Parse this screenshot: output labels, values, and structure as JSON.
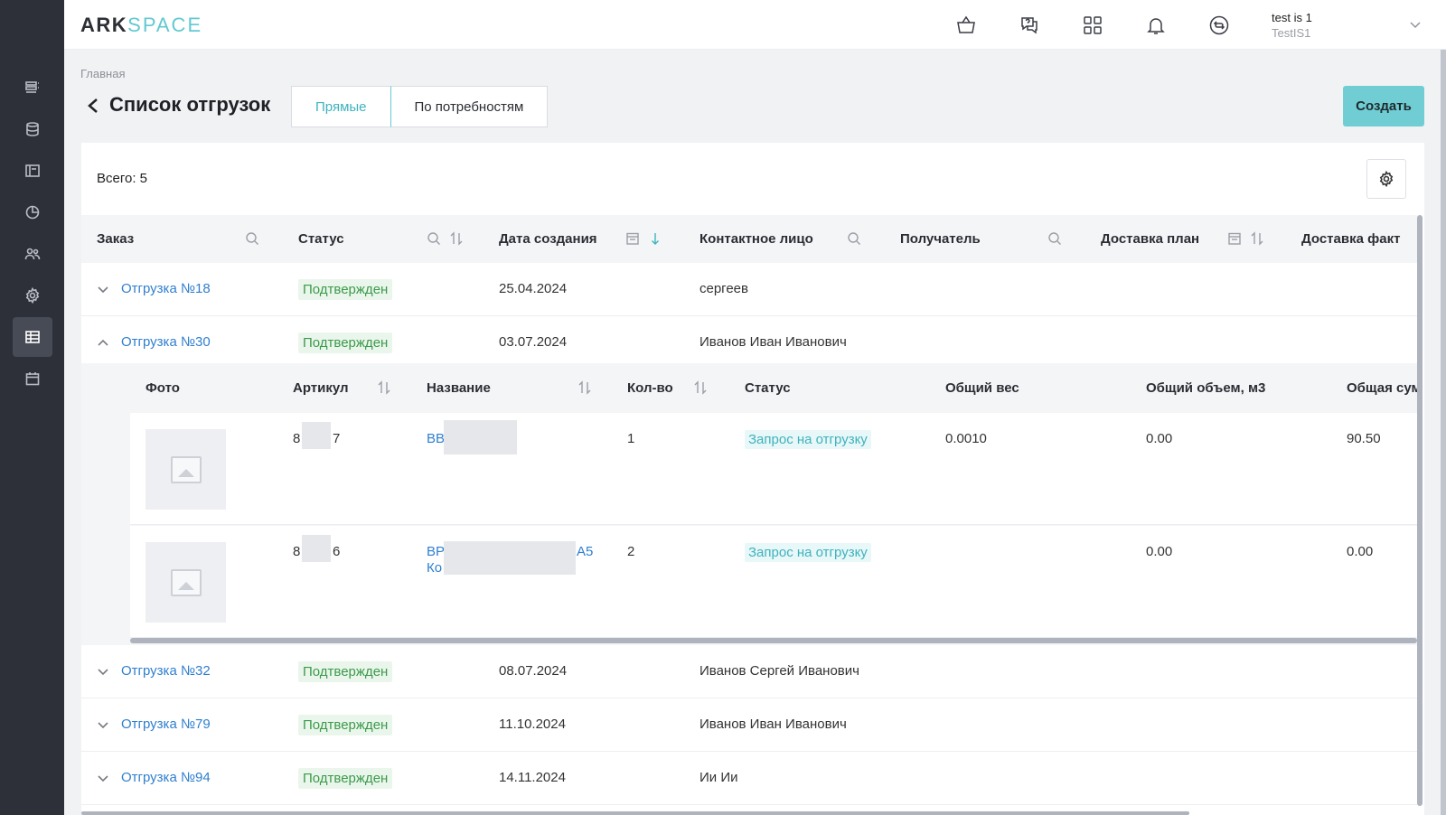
{
  "app": {
    "logo_a": "ARK",
    "logo_b": "SPACE"
  },
  "sidebar": {
    "items": [
      {
        "icon": "list-icon"
      },
      {
        "icon": "database-icon"
      },
      {
        "icon": "layout-icon"
      },
      {
        "icon": "pie-chart-icon"
      },
      {
        "icon": "users-icon"
      },
      {
        "icon": "gear-icon"
      },
      {
        "icon": "shipment-table-icon",
        "active": true
      },
      {
        "icon": "calendar-icon"
      }
    ]
  },
  "header": {
    "user_name": "test is 1",
    "user_org": "TestIS1",
    "icons": [
      "basket-icon",
      "chat-help-icon",
      "apps-grid-icon",
      "bell-icon",
      "sync-icon"
    ]
  },
  "page": {
    "breadcrumb": "Главная",
    "title": "Список отгрузок",
    "tabs": [
      {
        "label": "Прямые",
        "active": true
      },
      {
        "label": "По потребностям",
        "active": false
      }
    ],
    "create_label": "Создать"
  },
  "table": {
    "total": "Всего: 5",
    "columns": [
      "Заказ",
      "Статус",
      "Дата создания",
      "Контактное лицо",
      "Получатель",
      "Доставка план",
      "Доставка факт"
    ],
    "rows": [
      {
        "order": "Отгрузка №18",
        "status": "Подтвержден",
        "date": "25.04.2024",
        "contact": "сергеев"
      },
      {
        "order": "Отгрузка №30",
        "status": "Подтвержден",
        "date": "03.07.2024",
        "contact": "Иванов Иван Иванович"
      },
      {
        "order": "Отгрузка №32",
        "status": "Подтвержден",
        "date": "08.07.2024",
        "contact": "Иванов Сергей Иванович"
      },
      {
        "order": "Отгрузка №79",
        "status": "Подтвержден",
        "date": "11.10.2024",
        "contact": "Иванов Иван Иванович"
      },
      {
        "order": "Отгрузка №94",
        "status": "Подтвержден",
        "date": "14.11.2024",
        "contact": "Ии Ии"
      }
    ]
  },
  "nested": {
    "columns": [
      "Фото",
      "Артикул",
      "Название",
      "Кол-во",
      "Статус",
      "Общий вес",
      "Общий объем, м3",
      "Общая сум"
    ],
    "items": [
      {
        "article_a": "8",
        "article_b": "7",
        "name_a": "BB",
        "name_b": "",
        "qty": "1",
        "status": "Запрос на отгрузку",
        "weight": "0.0010",
        "volume": "0.00",
        "sum": "90.50"
      },
      {
        "article_a": "8",
        "article_b": "6",
        "name_a": "BP",
        "name_b": "A5",
        "name_c": "Ко",
        "qty": "2",
        "status": "Запрос на отгрузку",
        "weight": "",
        "volume": "0.00",
        "sum": "0.00"
      }
    ]
  }
}
